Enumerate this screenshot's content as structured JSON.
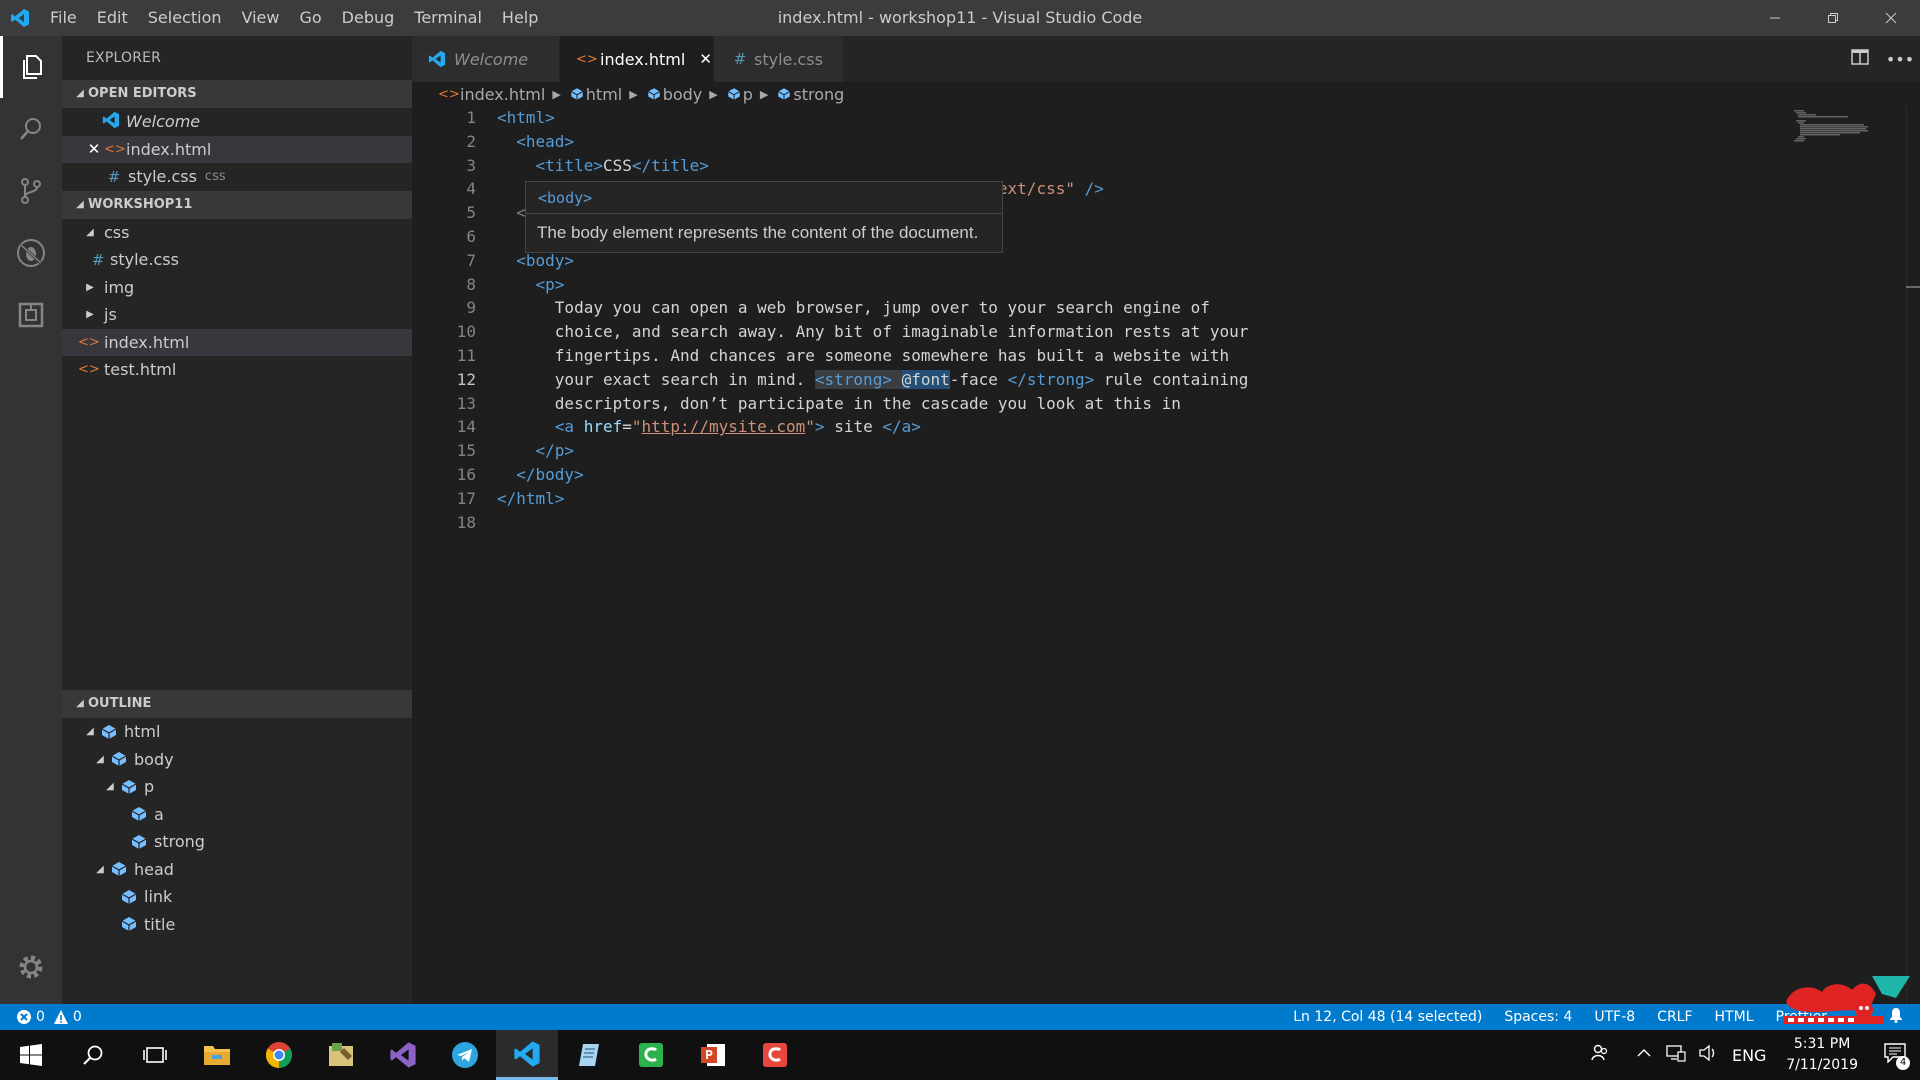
{
  "titlebar": {
    "menu": [
      "File",
      "Edit",
      "Selection",
      "View",
      "Go",
      "Debug",
      "Terminal",
      "Help"
    ],
    "title": "index.html - workshop11 - Visual Studio Code"
  },
  "sidebar": {
    "title": "EXPLORER",
    "open_editors": {
      "header": "OPEN EDITORS",
      "items": [
        {
          "label": "Welcome"
        },
        {
          "label": "index.html"
        },
        {
          "label": "style.css",
          "dir": "css"
        }
      ]
    },
    "workspace": {
      "header": "WORKSHOP11",
      "items": [
        "css",
        "style.css",
        "img",
        "js",
        "index.html",
        "test.html"
      ]
    },
    "outline": {
      "header": "OUTLINE",
      "items": [
        "html",
        "body",
        "p",
        "a",
        "strong",
        "head",
        "link",
        "title"
      ]
    }
  },
  "tabs": [
    {
      "label": "Welcome"
    },
    {
      "label": "index.html"
    },
    {
      "label": "style.css"
    }
  ],
  "breadcrumb": [
    "index.html",
    "html",
    "body",
    "p",
    "strong"
  ],
  "editor": {
    "line_numbers": [
      "1",
      "2",
      "3",
      "4",
      "5",
      "6",
      "7",
      "8",
      "9",
      "10",
      "11",
      "12",
      "13",
      "14",
      "15",
      "16",
      "17",
      "18"
    ],
    "current_line": "12",
    "lines": {
      "l1": "<html>",
      "l2": "<head>",
      "l3_open": "<title>",
      "l3_text": "CSS",
      "l3_close": "</title>",
      "l4_str": "\"text/css\"",
      "l4_end": "/>",
      "l5": "<",
      "l7": "<body>",
      "l8": "<p>",
      "l9": "Today you can open a web browser, jump over to your search engine of",
      "l10": "choice, and search away. Any bit of imaginable information rests at your",
      "l11": "fingertips. And chances are someone somewhere has built a website with",
      "l12_pre": "your exact search in mind. ",
      "l12_strong": "<strong>",
      "l12_font": "@font",
      "l12_face": "-face ",
      "l12_strong_close": "</strong>",
      "l12_post": " rule containing",
      "l13": "descriptors, don’t participate in the cascade you look at this in",
      "l14_a": "<a ",
      "l14_attr": "href",
      "l14_eq": "=",
      "l14_q1": "\"",
      "l14_url": "http://mysite.com",
      "l14_q2": "\"",
      "l14_gt": ">",
      "l14_text": " site ",
      "l14_close": "</a>",
      "l15": "</p>",
      "l16": "</body>",
      "l17": "</html>"
    },
    "hover": {
      "code": "<body>",
      "text": "The body element represents the content of the document."
    }
  },
  "statusbar": {
    "errors": "0",
    "warnings": "0",
    "position": "Ln 12, Col 48 (14 selected)",
    "spaces": "Spaces: 4",
    "encoding": "UTF-8",
    "eol": "CRLF",
    "language": "HTML",
    "prettier": "Prettier"
  },
  "taskbar": {
    "language": "ENG",
    "time": "5:31 PM",
    "date": "7/11/2019",
    "notifications": "4"
  },
  "colors": {
    "accent": "#007acc",
    "tag": "#569cd6",
    "string": "#ce9178",
    "attribute": "#9cdcfe"
  }
}
